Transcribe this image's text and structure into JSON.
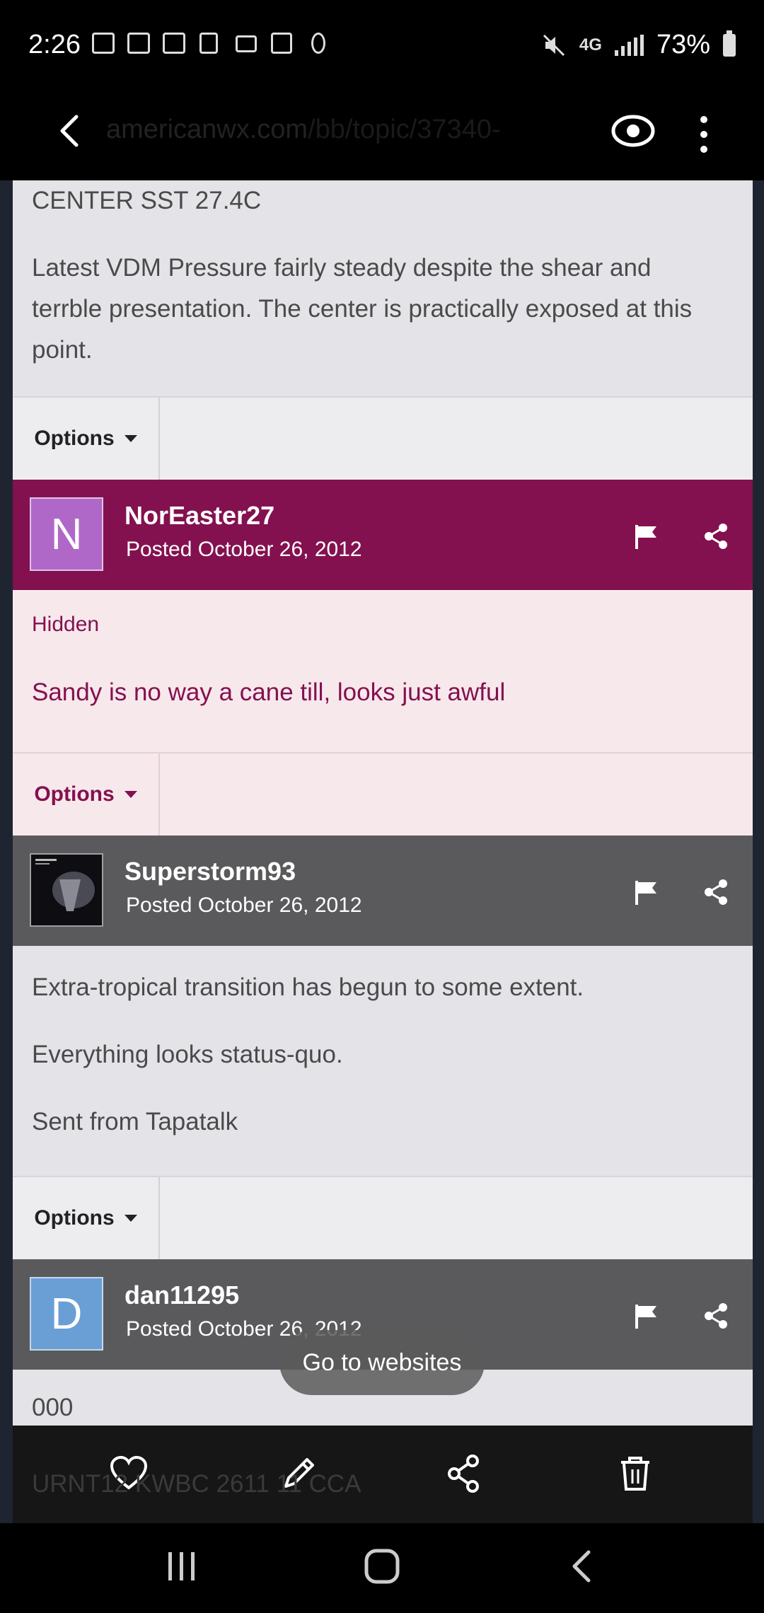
{
  "status_bar": {
    "time": "2:26",
    "battery": "73%",
    "network": "4G"
  },
  "url_bar": {
    "domain": "americanwx.com",
    "path": "/bb/topic/37340-"
  },
  "posts": [
    {
      "body_lines": [
        "CENTER SST 27.4C",
        "Latest VDM Pressure fairly steady despite the shear and",
        "terrble presentation. The center is practically exposed at this",
        "point."
      ],
      "options_label": "Options"
    },
    {
      "avatar_letter": "N",
      "username": "NorEaster27",
      "posted": "Posted October 26, 2012",
      "hidden_label": "Hidden",
      "body_lines": [
        "Sandy is no way a cane till, looks just awful"
      ],
      "options_label": "Options",
      "header_color": "#84114f",
      "avatar_color": "#b068c8"
    },
    {
      "username": "Superstorm93",
      "posted": "Posted October 26, 2012",
      "body_lines": [
        "Extra-tropical transition has begun to some extent.",
        "Everything looks status-quo.",
        "Sent from Tapatalk"
      ],
      "options_label": "Options",
      "header_color": "#5a5a5c"
    },
    {
      "avatar_letter": "D",
      "username": "dan11295",
      "posted": "Posted October 26, 2012",
      "body_lines": [
        "000",
        "URNT12 KWBC 2611 11 CCA"
      ],
      "header_color": "#5a5a5c",
      "avatar_color": "#6a9fd6"
    }
  ],
  "toast": "Go to websites",
  "colors": {
    "hidden_bg": "#f7e8ec",
    "hidden_text": "#84114f"
  }
}
